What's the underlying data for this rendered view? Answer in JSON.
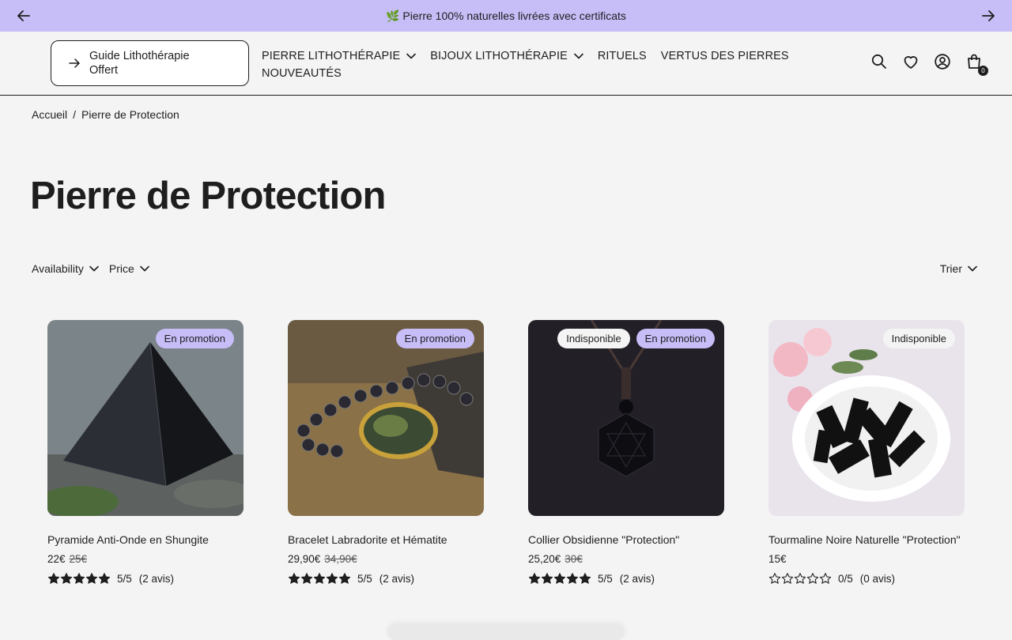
{
  "announcement": {
    "text": "🌿 Pierre 100% naturelles livrées avec certificats"
  },
  "header": {
    "guide_button": "Guide Lithothérapie Offert",
    "nav": [
      {
        "label": "PIERRE LITHOTHÉRAPIE",
        "has_dropdown": true
      },
      {
        "label": "BIJOUX LITHOTHÉRAPIE",
        "has_dropdown": true
      },
      {
        "label": "RITUELS",
        "has_dropdown": false
      },
      {
        "label": "VERTUS DES PIERRES",
        "has_dropdown": false
      },
      {
        "label": "NOUVEAUTÉS",
        "has_dropdown": false
      }
    ],
    "cart_count": "0"
  },
  "breadcrumb": {
    "home": "Accueil",
    "separator": "/",
    "current": "Pierre de Protection"
  },
  "page": {
    "title": "Pierre de Protection"
  },
  "filters": {
    "availability": "Availability",
    "price": "Price",
    "sort": "Trier"
  },
  "products": [
    {
      "title": "Pyramide Anti-Onde en Shungite",
      "price": "22€",
      "old_price": "25€",
      "badges": [
        "En promotion"
      ],
      "rating_value": 5,
      "rating": "5/5",
      "reviews": "(2 avis)"
    },
    {
      "title": "Bracelet Labradorite et Hématite",
      "price": "29,90€",
      "old_price": "34,90€",
      "badges": [
        "En promotion"
      ],
      "rating_value": 5,
      "rating": "5/5",
      "reviews": "(2 avis)"
    },
    {
      "title": "Collier Obsidienne \"Protection\"",
      "price": "25,20€",
      "old_price": "30€",
      "badges": [
        "Indisponible",
        "En promotion"
      ],
      "rating_value": 5,
      "rating": "5/5",
      "reviews": "(2 avis)"
    },
    {
      "title": "Tourmaline Noire Naturelle \"Protection\"",
      "price": "15€",
      "old_price": "",
      "badges": [
        "Indisponible"
      ],
      "rating_value": 0,
      "rating": "0/5",
      "reviews": "(0 avis)"
    }
  ],
  "colors": {
    "accent": "#c7bdf7",
    "text": "#1e1e1e",
    "background": "#f4f4f4"
  }
}
